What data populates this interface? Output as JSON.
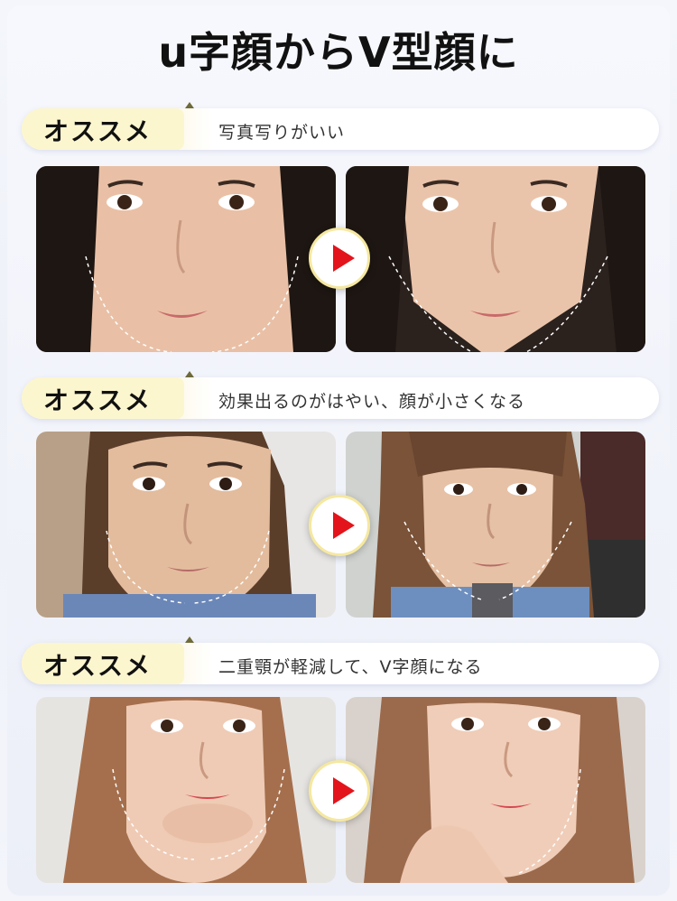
{
  "title": "u字顔からV型顔に",
  "sections": [
    {
      "badge": "オススメ",
      "description": "写真写りがいい",
      "before_image": "face-before-1",
      "after_image": "face-after-1"
    },
    {
      "badge": "オススメ",
      "description": "効果出るのがはやい、顔が小さくなる",
      "before_image": "face-before-2",
      "after_image": "face-after-2"
    },
    {
      "badge": "オススメ",
      "description": "二重顎が軽減して、V字顔になる",
      "before_image": "face-before-3",
      "after_image": "face-after-3"
    }
  ],
  "colors": {
    "accent_arrow": "#e3141b",
    "badge_bg": "#fcf6cf",
    "background": "#eef1f8"
  },
  "icons": {
    "arrow": "play-arrow-icon"
  }
}
